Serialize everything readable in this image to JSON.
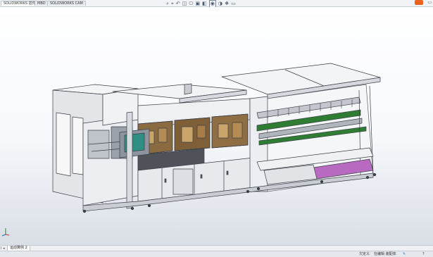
{
  "command_tabs": [
    "SOLIDWORKS 插件",
    "MBD",
    "SOLIDWORKS CAM"
  ],
  "view_toolbar": {
    "icons": [
      "zoom-to-fit-icon",
      "zoom-area-icon",
      "previous-view-icon",
      "section-view-icon",
      "dynamic-annotation-icon",
      "view-orientation-icon",
      "display-style-icon",
      "hide-show-icon",
      "edit-appearance-icon",
      "apply-scene-icon",
      "view-settings-icon"
    ],
    "glyphs": [
      "⌕",
      "⌖",
      "↶",
      "◫",
      "⎔",
      "▣",
      "◧",
      "◉",
      "◑",
      "❖",
      "▭"
    ]
  },
  "sheet_tabs": {
    "nav": "I ◂",
    "active": "运动算例 2"
  },
  "status": {
    "units": "欠定义",
    "mode": "在编辑 装配体",
    "help": "?"
  },
  "colors": {
    "frame": "#e9ebee",
    "outline": "#3b3f46",
    "hmi_screen": "#2f8f82",
    "glass": "#8a6a40",
    "conveyor_green": "#2e7d32",
    "tray_purple": "#b76ac0",
    "triad_x": "#d32f2f",
    "triad_y": "#2e7d32",
    "triad_z": "#1565c0"
  }
}
